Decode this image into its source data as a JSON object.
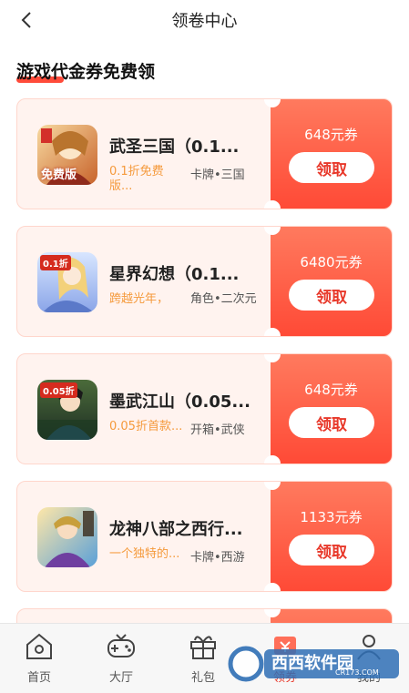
{
  "header": {
    "title": "领卷中心",
    "back_icon": "chevron-left-icon"
  },
  "section": {
    "title": "游戏代金券免费领",
    "underline_color": "#ff4b3a"
  },
  "coupons": [
    {
      "name": "武圣三国（0.1...",
      "desc": "0.1折免费版...",
      "tags": "卡牌•三国",
      "amount": "648元券",
      "button": "领取",
      "icon_text": "免费版"
    },
    {
      "name": "星界幻想（0.1...",
      "desc": "跨越光年，",
      "tags": "角色•二次元",
      "amount": "6480元券",
      "button": "领取",
      "icon_text": "0.1折"
    },
    {
      "name": "墨武江山（0.05...",
      "desc": "0.05折首款...",
      "tags": "开箱•武侠",
      "amount": "648元券",
      "button": "领取",
      "icon_text": "0.05折"
    },
    {
      "name": "龙神八部之西行...",
      "desc": "一个独特的...",
      "tags": "卡牌•西游",
      "amount": "1133元券",
      "button": "领取",
      "icon_text": ""
    }
  ],
  "nav": [
    {
      "label": "首页",
      "icon": "home-icon"
    },
    {
      "label": "大厅",
      "icon": "gamepad-icon"
    },
    {
      "label": "礼包",
      "icon": "gift-icon"
    },
    {
      "label": "领券",
      "icon": "coupon-icon"
    },
    {
      "label": "我的",
      "icon": "user-icon"
    }
  ],
  "watermark": {
    "text": "西西软件园",
    "sub": "CR173.COM"
  },
  "colors": {
    "accent": "#e8382a",
    "coupon_bg": "#fff3ef",
    "coupon_right_top": "#ff7a5e",
    "coupon_right_bottom": "#ff4a36",
    "desc": "#f59a3c"
  }
}
